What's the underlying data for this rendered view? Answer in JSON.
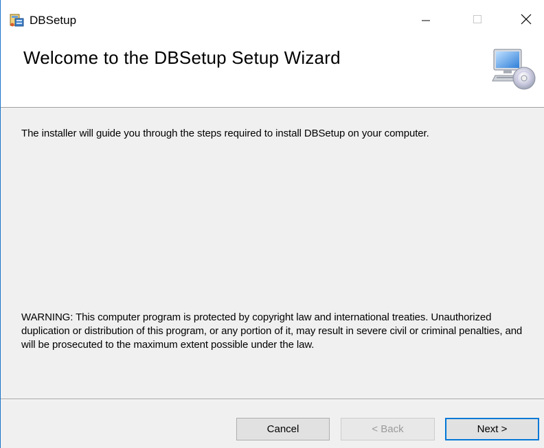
{
  "window": {
    "title": "DBSetup"
  },
  "titlebar": {
    "minimize_icon": "minimize-icon",
    "maximize_icon": "maximize-icon",
    "close_icon": "close-icon"
  },
  "banner": {
    "heading": "Welcome to the DBSetup Setup Wizard",
    "icon": "computer-cd-icon"
  },
  "body": {
    "intro": "The installer will guide you through the steps required to install DBSetup on your computer.",
    "warning": "WARNING: This computer program is protected by copyright law and international treaties. Unauthorized duplication or distribution of this program, or any portion of it, may result in severe civil or criminal penalties, and will be prosecuted to the maximum extent possible under the law."
  },
  "buttons": {
    "cancel": "Cancel",
    "back": "< Back",
    "next": "Next >"
  },
  "colors": {
    "accent": "#0078d7",
    "window_border": "#1a73c7",
    "background": "#f0f0f0"
  }
}
